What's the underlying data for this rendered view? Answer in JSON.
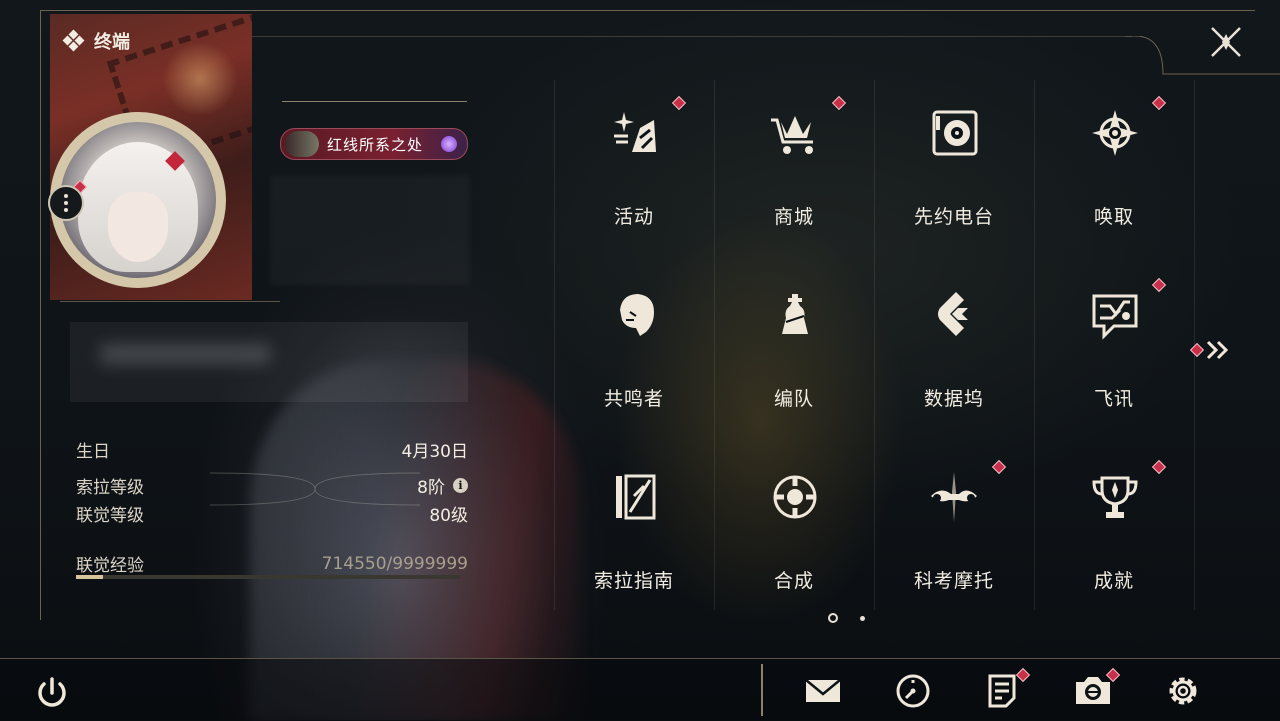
{
  "header": {
    "title": "终端"
  },
  "profile": {
    "badge_text": "红线所系之处"
  },
  "info": [
    {
      "label": "生日",
      "value": "4月30日"
    },
    {
      "label": "索拉等级",
      "value": "8阶"
    },
    {
      "label": "联觉等级",
      "value": "80级"
    },
    {
      "label": "联觉经验",
      "value": "714550/9999999"
    }
  ],
  "experience_progress": 0.0715,
  "menu": [
    {
      "label": "活动",
      "icon": "sparkle-icon",
      "alert": true
    },
    {
      "label": "商城",
      "icon": "crown-cart-icon",
      "alert": true
    },
    {
      "label": "先约电台",
      "icon": "radio-icon",
      "alert": false
    },
    {
      "label": "唤取",
      "icon": "compass-star-icon",
      "alert": true
    },
    {
      "label": "共鸣者",
      "icon": "character-head-icon",
      "alert": false
    },
    {
      "label": "编队",
      "icon": "chess-piece-icon",
      "alert": false
    },
    {
      "label": "数据坞",
      "icon": "data-dock-icon",
      "alert": false
    },
    {
      "label": "飞讯",
      "icon": "chat-bubble-icon",
      "alert": true
    },
    {
      "label": "索拉指南",
      "icon": "guide-book-icon",
      "alert": false
    },
    {
      "label": "合成",
      "icon": "synthesis-icon",
      "alert": false
    },
    {
      "label": "科考摩托",
      "icon": "motorbike-icon",
      "alert": true
    },
    {
      "label": "成就",
      "icon": "trophy-icon",
      "alert": true
    }
  ],
  "pager": {
    "pages": 2,
    "current": 1
  },
  "bottom_bar": [
    {
      "icon": "mail-icon",
      "alert": false
    },
    {
      "icon": "clock-icon",
      "alert": false
    },
    {
      "icon": "notice-icon",
      "alert": true
    },
    {
      "icon": "camera-icon",
      "alert": true
    },
    {
      "icon": "settings-gear-icon",
      "alert": false
    }
  ],
  "colors": {
    "accent": "#c8304a",
    "text": "#f1ece1",
    "line": "#6b6250"
  }
}
